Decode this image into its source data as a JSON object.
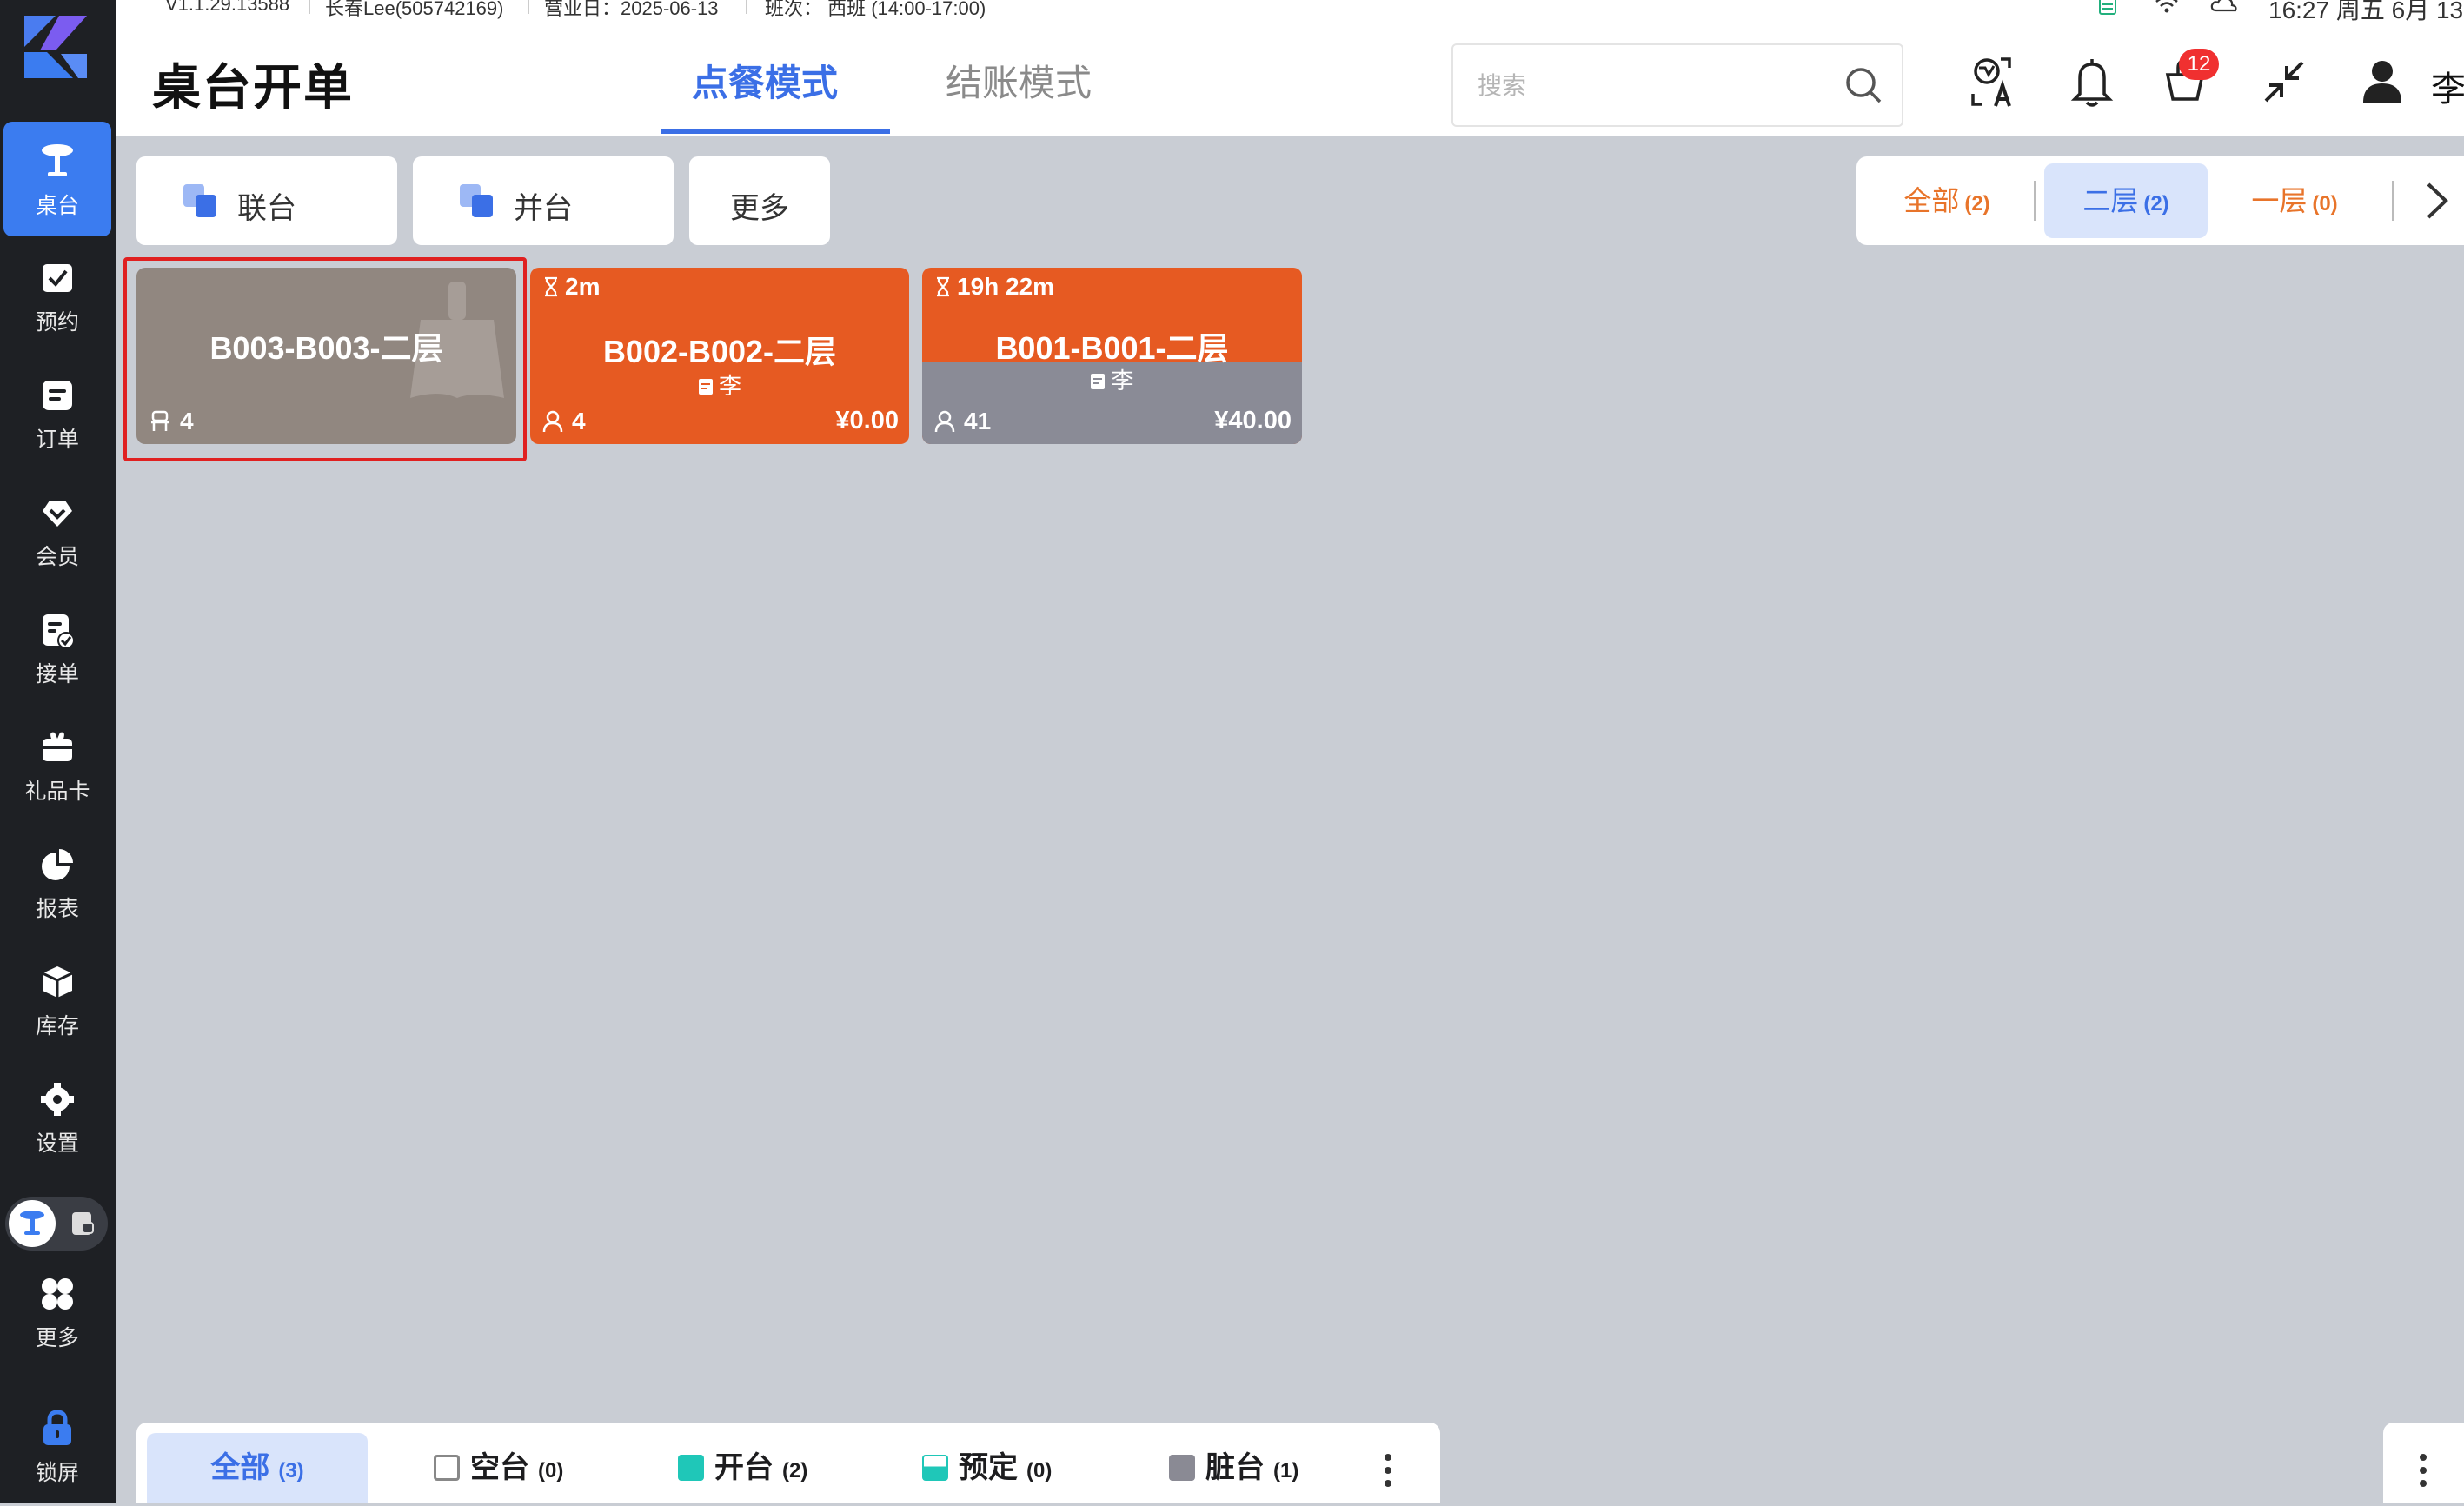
{
  "status_bar": {
    "version": "V1.1.29.13588",
    "store": "长春Lee(505742169)",
    "business_day": "营业日：2025-06-13",
    "shift": "班次：  西班 (14:00-17:00)",
    "clock": "16:27 周五 6月 13"
  },
  "sidebar": {
    "items": [
      {
        "label": "桌台",
        "icon": "dining-table-icon"
      },
      {
        "label": "预约",
        "icon": "calendar-check-icon"
      },
      {
        "label": "订单",
        "icon": "order-list-icon"
      },
      {
        "label": "会员",
        "icon": "member-heart-icon"
      },
      {
        "label": "接单",
        "icon": "accept-order-icon"
      },
      {
        "label": "礼品卡",
        "icon": "gift-card-icon"
      },
      {
        "label": "报表",
        "icon": "pie-chart-icon"
      },
      {
        "label": "库存",
        "icon": "inventory-box-icon"
      },
      {
        "label": "设置",
        "icon": "gear-icon"
      },
      {
        "label": "更多",
        "icon": "grid-more-icon"
      },
      {
        "label": "锁屏",
        "icon": "lock-icon"
      }
    ]
  },
  "header": {
    "title": "桌台开单",
    "tabs": [
      {
        "label": "点餐模式",
        "active": true
      },
      {
        "label": "结账模式",
        "active": false
      }
    ],
    "search_placeholder": "搜索",
    "notification_badge": "12",
    "user_name": "李"
  },
  "toolbar": {
    "merge_label": "联台",
    "combine_label": "并台",
    "more_label": "更多"
  },
  "floor_filter": {
    "tabs": [
      {
        "label": "全部",
        "count": "(2)",
        "active": false
      },
      {
        "label": "二层",
        "count": "(2)",
        "active": true
      },
      {
        "label": "一层",
        "count": "(0)",
        "active": false
      }
    ]
  },
  "tables": [
    {
      "name": "B003-B003-二层",
      "status": "dirty",
      "seats": "4",
      "timer": "",
      "waiter": "",
      "amount": ""
    },
    {
      "name": "B002-B002-二层",
      "status": "open",
      "timer": "2m",
      "waiter": "李",
      "guests": "4",
      "amount": "¥0.00"
    },
    {
      "name": "B001-B001-二层",
      "status": "open",
      "timer": "19h 22m",
      "waiter": "李",
      "guests": "41",
      "amount": "¥40.00"
    }
  ],
  "legend": {
    "items": [
      {
        "label": "全部",
        "count": "(3)",
        "active": true
      },
      {
        "label": "空台",
        "count": "(0)",
        "color": "#ffffff"
      },
      {
        "label": "开台",
        "count": "(2)",
        "color": "#1fc7b8"
      },
      {
        "label": "预定",
        "count": "(0)",
        "color": "#1fc7b8"
      },
      {
        "label": "脏台",
        "count": "(1)",
        "color": "#8a8a94"
      }
    ]
  },
  "colors": {
    "accent": "#3b6fe6",
    "sidebar_active": "#3b7cf0",
    "open_table": "#e65a22",
    "dirty_table": "#918780",
    "floor_tab_text": "#e8742a"
  }
}
